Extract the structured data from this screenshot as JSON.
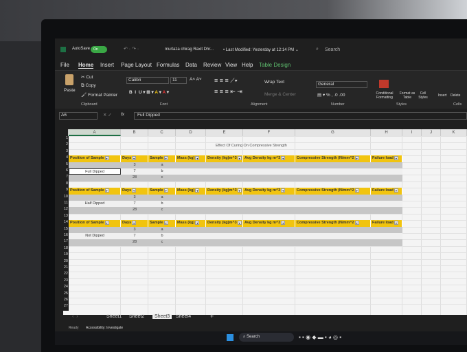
{
  "titlebar": {
    "autosave": "AutoSave",
    "toggle": "On",
    "filename": "murtaza chirag Raxit Dhr...",
    "modified": "• Last Modified: Yesterday at 12:14 PM ⌄",
    "search": "Search"
  },
  "menu": [
    "File",
    "Home",
    "Insert",
    "Page Layout",
    "Formulas",
    "Data",
    "Review",
    "View",
    "Help",
    "Table Design"
  ],
  "ribbon": {
    "paste": "Paste",
    "cut": "Cut",
    "copy": "Copy",
    "format_painter": "Format Painter",
    "clipboard": "Clipboard",
    "font_name": "Calibri",
    "font_size": "11",
    "font": "Font",
    "wrap": "Wrap Text",
    "merge": "Merge & Center",
    "alignment": "Alignment",
    "number_format": "General",
    "number": "Number",
    "conditional": "Conditional Formatting",
    "format_table": "Format as Table",
    "cell_styles": "Cell Styles",
    "styles": "Styles",
    "insert": "Insert",
    "delete": "Delete",
    "cells": "Cells"
  },
  "formula": {
    "namebox": "A6",
    "fx": "fx",
    "value": "Full Dipped"
  },
  "columns": [
    "A",
    "B",
    "C",
    "D",
    "E",
    "F",
    "G",
    "H",
    "I",
    "J",
    "K"
  ],
  "sheet_title": "Effect Of Curing On  Compressive Strength",
  "headers": [
    "Position of Sample",
    "Days",
    "Sample",
    "Mass (kg)",
    "Density (kg)m^3",
    "Avg Density kg m^3",
    "Compressive Strength (N/mm^2",
    "Failure load"
  ],
  "tables": [
    {
      "position": "Full Dipped",
      "days": [
        "3",
        "7",
        "28"
      ],
      "samples": [
        "a",
        "b",
        "c"
      ]
    },
    {
      "position": "Half  Dipped",
      "days": [
        "3",
        "7",
        "28"
      ],
      "samples": [
        "a",
        "b",
        "c"
      ]
    },
    {
      "position": "Not Dipped",
      "days": [
        "3",
        "7",
        "28"
      ],
      "samples": [
        "a",
        "b",
        "c"
      ]
    }
  ],
  "sheets": [
    "Sheet1",
    "Sheet2",
    "Sheet3",
    "Sheet4"
  ],
  "active_sheet": "Sheet3",
  "status": {
    "ready": "Ready",
    "accessibility": "Accessibility: Investigate"
  },
  "taskbar": {
    "search": "Search"
  }
}
